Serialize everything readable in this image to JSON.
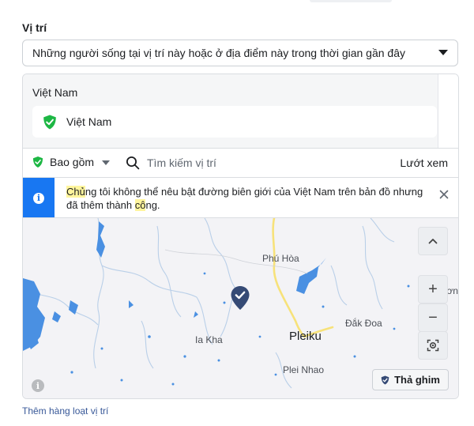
{
  "location": {
    "section_label": "Vị trí",
    "audience_select": {
      "selected": "Những người sống tại vị trí này hoặc ở địa điểm này trong thời gian gần đây"
    },
    "country_group": {
      "title": "Việt Nam",
      "chips": [
        {
          "label": "Việt Nam",
          "icon": "shield-check-icon",
          "color": "#1db744"
        }
      ]
    },
    "toolbar": {
      "include_label": "Bao gồm",
      "search_placeholder": "Tìm kiếm vị trí",
      "browse_label": "Lướt xem"
    },
    "notice": {
      "part1": "Chủ",
      "part2": "ng tôi không thể nêu bật đường biên giới của Việt Nam trên bản đồ nhưng đã thêm thành ",
      "part3": "cô",
      "part4": "ng."
    },
    "map": {
      "places": {
        "phu_hoa": "Phú Hòa",
        "kon_dong": "Kon Dơn",
        "dak_doa": "Đắk Đoa",
        "ia_kha": "Ia Kha",
        "pleiku": "Pleiku",
        "plei_nhao": "Plei Nhao"
      },
      "pin_label": "Thả ghim",
      "zoom_in": "+",
      "zoom_out": "−",
      "water_color": "#4a90e2",
      "road_color": "#f7e27a"
    },
    "bulk_add_link": "Thêm hàng loạt vị trí"
  }
}
